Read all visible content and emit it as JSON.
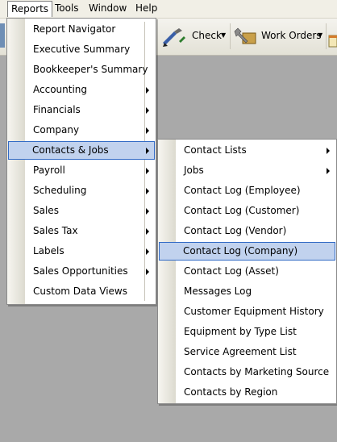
{
  "menubar": {
    "items": [
      {
        "label": "Reports",
        "mnemonic": "R"
      },
      {
        "label": "Tools",
        "mnemonic": "T"
      },
      {
        "label": "Window",
        "mnemonic": "W"
      },
      {
        "label": "Help",
        "mnemonic": "H"
      }
    ]
  },
  "toolbar": {
    "check_label": "Check",
    "work_orders_label": "Work Orders"
  },
  "reports_menu": {
    "items": [
      {
        "label": "Report Navigator",
        "submenu": false
      },
      {
        "label": "Executive Summary",
        "submenu": false
      },
      {
        "label": "Bookkeeper's Summary",
        "submenu": false
      },
      {
        "label": "Accounting",
        "submenu": true
      },
      {
        "label": "Financials",
        "submenu": true
      },
      {
        "label": "Company",
        "submenu": true
      },
      {
        "label": "Contacts & Jobs",
        "submenu": true,
        "highlighted": true
      },
      {
        "label": "Payroll",
        "submenu": true
      },
      {
        "label": "Scheduling",
        "submenu": true
      },
      {
        "label": "Sales",
        "submenu": true
      },
      {
        "label": "Sales Tax",
        "submenu": true
      },
      {
        "label": "Labels",
        "submenu": true
      },
      {
        "label": "Sales Opportunities",
        "submenu": true
      },
      {
        "label": "Custom Data Views",
        "submenu": false
      }
    ]
  },
  "contacts_submenu": {
    "items": [
      {
        "label": "Contact Lists",
        "submenu": true
      },
      {
        "label": "Jobs",
        "submenu": true
      },
      {
        "label": "Contact Log (Employee)",
        "submenu": false
      },
      {
        "label": "Contact Log (Customer)",
        "submenu": false
      },
      {
        "label": "Contact Log (Vendor)",
        "submenu": false
      },
      {
        "label": "Contact Log (Company)",
        "submenu": false,
        "highlighted": true
      },
      {
        "label": "Contact Log (Asset)",
        "submenu": false
      },
      {
        "label": "Messages Log",
        "submenu": false
      },
      {
        "label": "Customer Equipment History",
        "submenu": false
      },
      {
        "label": "Equipment by Type List",
        "submenu": false
      },
      {
        "label": "Service Agreement List",
        "submenu": false
      },
      {
        "label": "Contacts by Marketing Source",
        "submenu": false
      },
      {
        "label": "Contacts by Region",
        "submenu": false
      }
    ]
  },
  "colors": {
    "highlight_fill": "#c1d2ee",
    "highlight_border": "#316ac5",
    "workspace": "#a9a9a9"
  }
}
